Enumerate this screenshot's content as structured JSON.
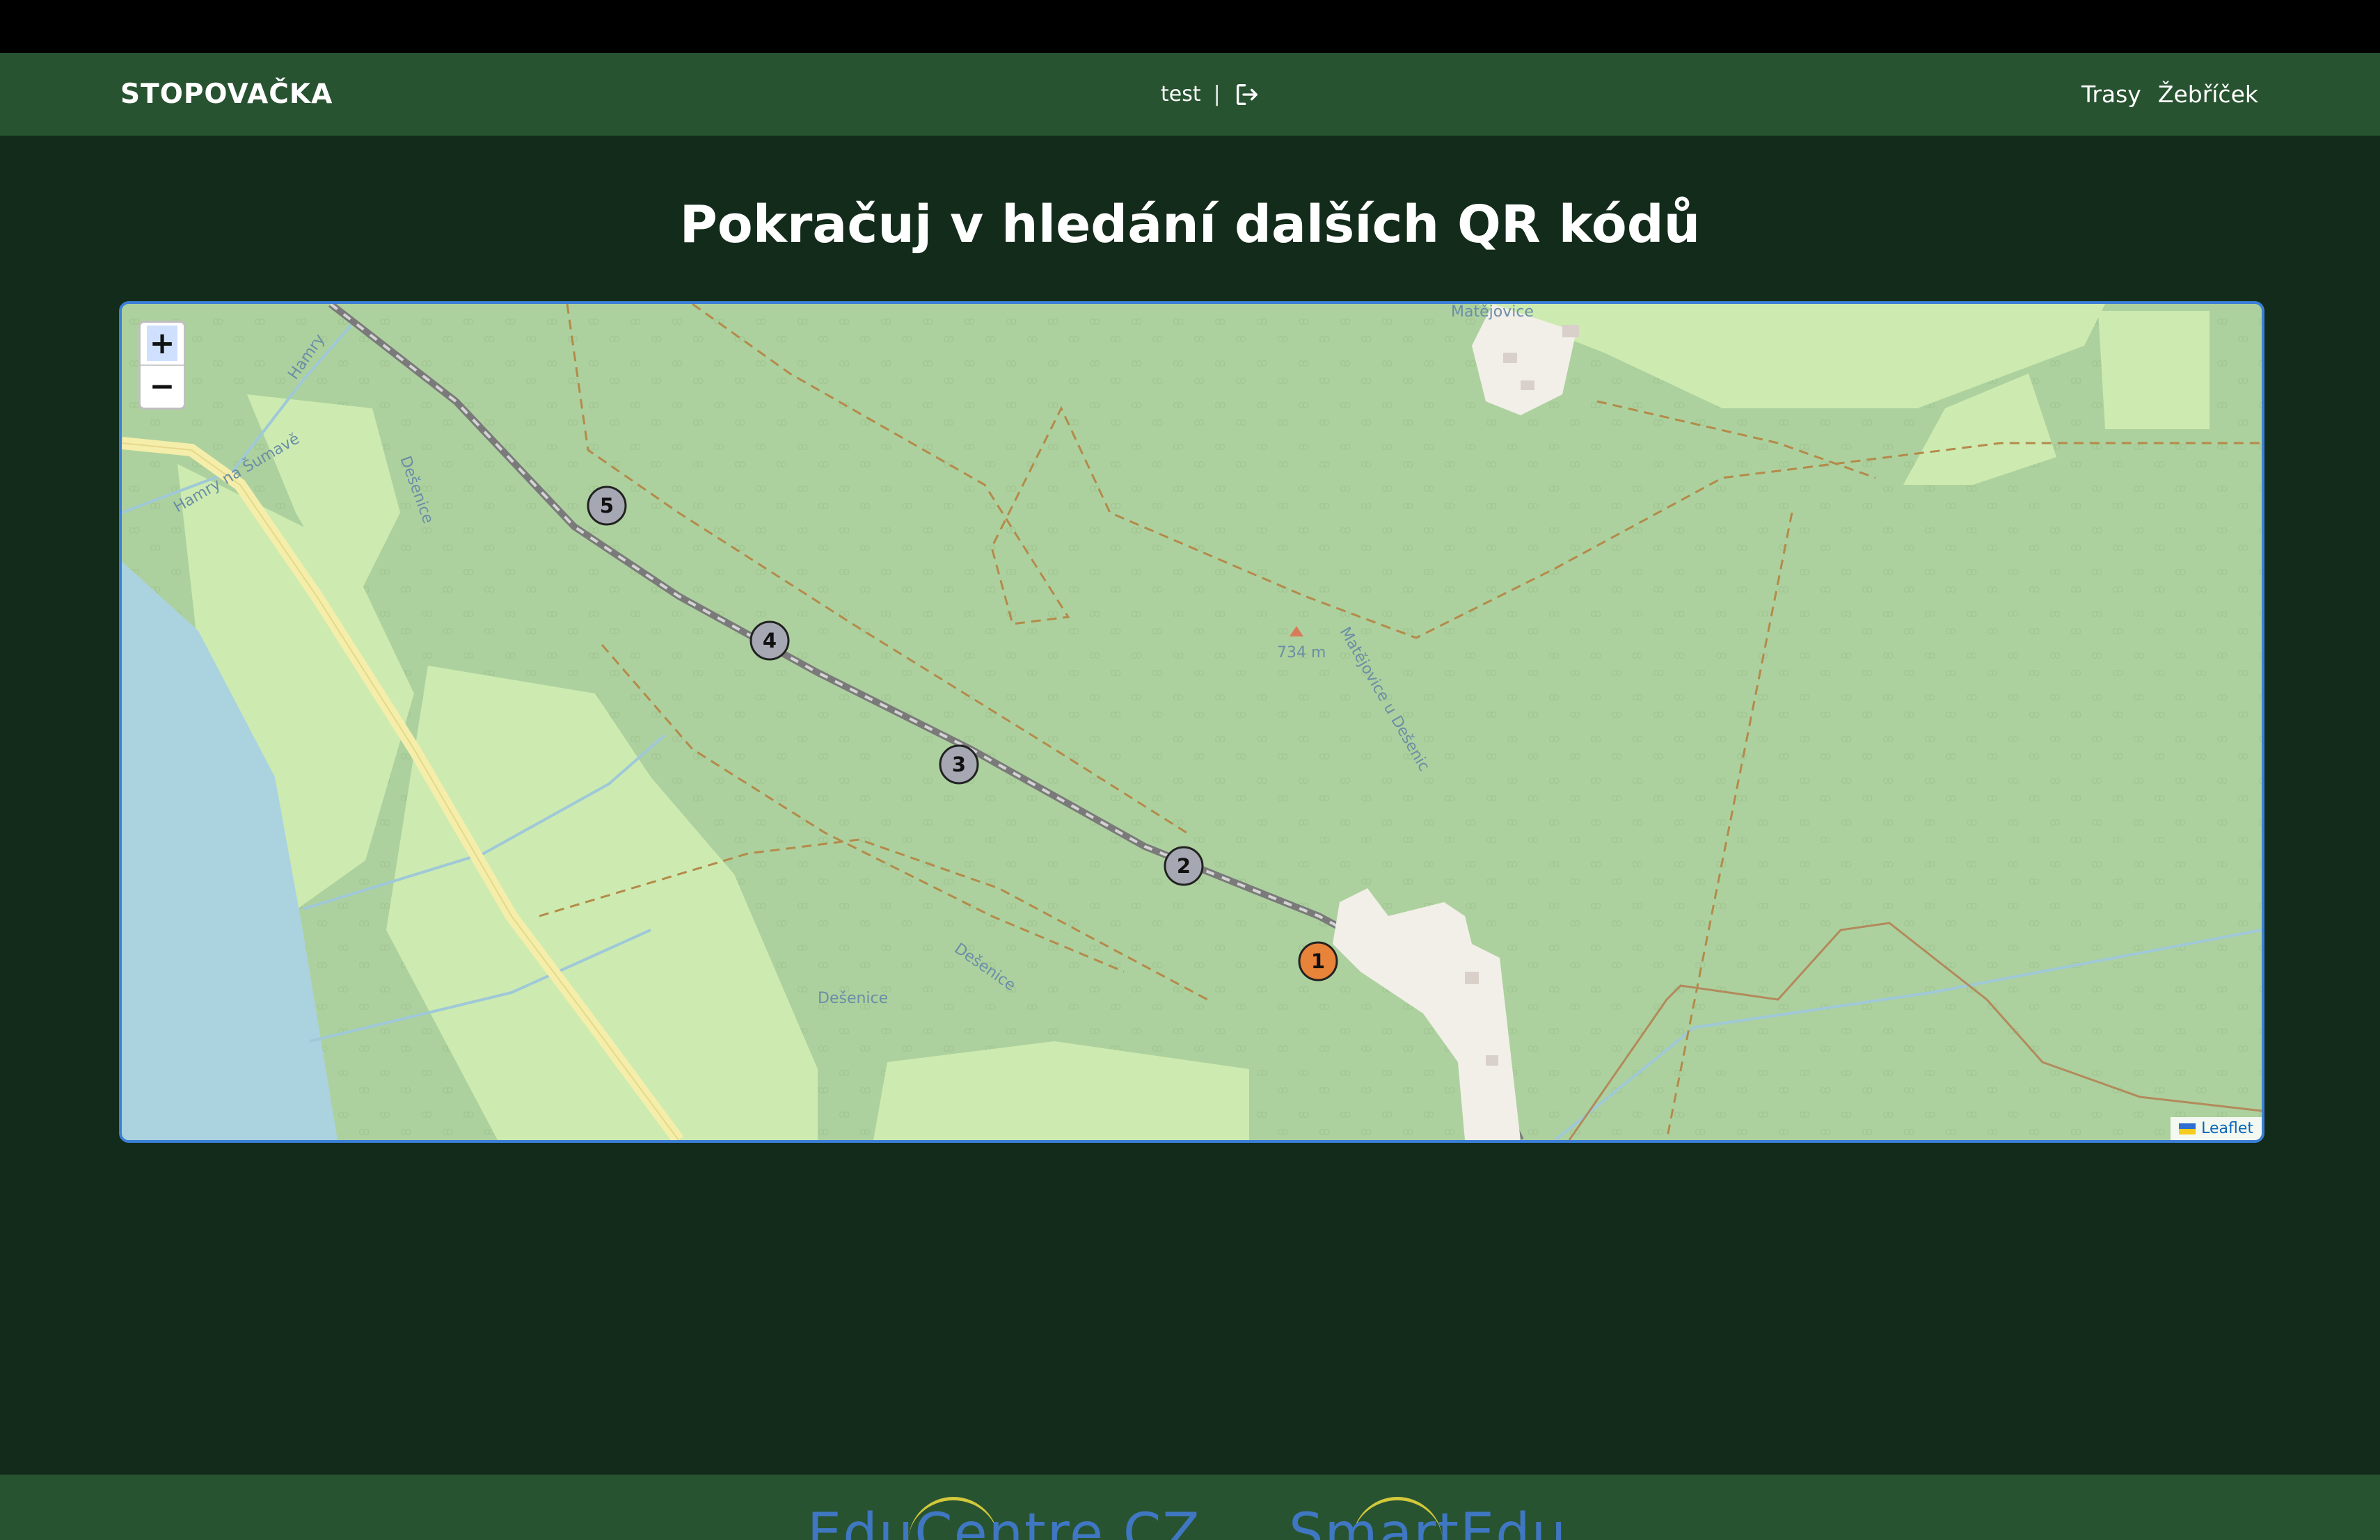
{
  "navbar": {
    "brand": "STOPOVAČKA",
    "username": "test",
    "separator": "|",
    "logout_icon": "logout-icon",
    "links": [
      "Trasy",
      "Žebříček"
    ]
  },
  "heading": "Pokračuj v hledání dalších QR kódů",
  "map": {
    "zoom_in": "+",
    "zoom_out": "−",
    "attribution": "Leaflet",
    "place_labels": [
      "Matějovice",
      "734 m",
      "Matějovice u Dešenic",
      "Dešenice",
      "Dešenice",
      "Hamry na Šumavě",
      "Hamry",
      "Dešenice"
    ],
    "markers": [
      {
        "label": "1",
        "status": "current",
        "color": "#e8833a"
      },
      {
        "label": "2",
        "status": "pending",
        "color": "#a5a8b3"
      },
      {
        "label": "3",
        "status": "pending",
        "color": "#a5a8b3"
      },
      {
        "label": "4",
        "status": "pending",
        "color": "#a5a8b3"
      },
      {
        "label": "5",
        "status": "pending",
        "color": "#a5a8b3"
      }
    ]
  },
  "footer": {
    "logos": [
      "EduCentre.CZ",
      "SmartEdu"
    ]
  }
}
